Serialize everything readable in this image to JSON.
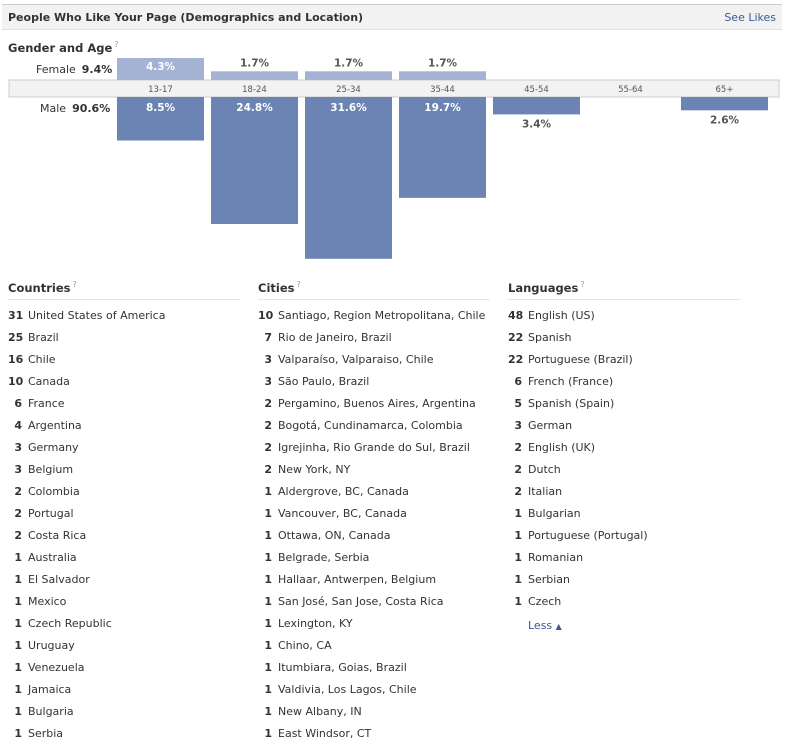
{
  "header": {
    "title": "People Who Like Your Page (Demographics and Location)",
    "see_likes": "See Likes"
  },
  "gender_age": {
    "title": "Gender and Age",
    "help": "?",
    "female_label": "Female",
    "female_pct": "9.4%",
    "male_label": "Male",
    "male_pct": "90.6%"
  },
  "colors": {
    "female": "#a4b3d4",
    "male": "#6b84b4",
    "axis_bg": "#f2f2f2",
    "link": "#3b5998"
  },
  "chart_data": {
    "type": "bar",
    "categories": [
      "13-17",
      "18-24",
      "25-34",
      "35-44",
      "45-54",
      "55-64",
      "65+"
    ],
    "series": [
      {
        "name": "Female",
        "values": [
          4.3,
          1.7,
          1.7,
          1.7,
          null,
          null,
          null
        ],
        "labels": [
          "4.3%",
          "1.7%",
          "1.7%",
          "1.7%",
          "",
          "",
          ""
        ]
      },
      {
        "name": "Male",
        "values": [
          8.5,
          24.8,
          31.6,
          19.7,
          3.4,
          null,
          2.6
        ],
        "labels": [
          "8.5%",
          "24.8%",
          "31.6%",
          "19.7%",
          "3.4%",
          "",
          "2.6%"
        ]
      }
    ]
  },
  "countries": {
    "title": "Countries",
    "help": "?",
    "items": [
      {
        "count": "31",
        "name": "United States of America"
      },
      {
        "count": "25",
        "name": "Brazil"
      },
      {
        "count": "16",
        "name": "Chile"
      },
      {
        "count": "10",
        "name": "Canada"
      },
      {
        "count": "6",
        "name": "France"
      },
      {
        "count": "4",
        "name": "Argentina"
      },
      {
        "count": "3",
        "name": "Germany"
      },
      {
        "count": "3",
        "name": "Belgium"
      },
      {
        "count": "2",
        "name": "Colombia"
      },
      {
        "count": "2",
        "name": "Portugal"
      },
      {
        "count": "2",
        "name": "Costa Rica"
      },
      {
        "count": "1",
        "name": "Australia"
      },
      {
        "count": "1",
        "name": "El Salvador"
      },
      {
        "count": "1",
        "name": "Mexico"
      },
      {
        "count": "1",
        "name": "Czech Republic"
      },
      {
        "count": "1",
        "name": "Uruguay"
      },
      {
        "count": "1",
        "name": "Venezuela"
      },
      {
        "count": "1",
        "name": "Jamaica"
      },
      {
        "count": "1",
        "name": "Bulgaria"
      },
      {
        "count": "1",
        "name": "Serbia"
      }
    ]
  },
  "cities": {
    "title": "Cities",
    "help": "?",
    "items": [
      {
        "count": "10",
        "name": "Santiago, Region Metropolitana, Chile"
      },
      {
        "count": "7",
        "name": "Rio de Janeiro, Brazil"
      },
      {
        "count": "3",
        "name": "Valparaíso, Valparaiso, Chile"
      },
      {
        "count": "3",
        "name": "São Paulo, Brazil"
      },
      {
        "count": "2",
        "name": "Pergamino, Buenos Aires, Argentina"
      },
      {
        "count": "2",
        "name": "Bogotá, Cundinamarca, Colombia"
      },
      {
        "count": "2",
        "name": "Igrejinha, Rio Grande do Sul, Brazil"
      },
      {
        "count": "2",
        "name": "New York, NY"
      },
      {
        "count": "1",
        "name": "Aldergrove, BC, Canada"
      },
      {
        "count": "1",
        "name": "Vancouver, BC, Canada"
      },
      {
        "count": "1",
        "name": "Ottawa, ON, Canada"
      },
      {
        "count": "1",
        "name": "Belgrade, Serbia"
      },
      {
        "count": "1",
        "name": "Hallaar, Antwerpen, Belgium"
      },
      {
        "count": "1",
        "name": "San José, San Jose, Costa Rica"
      },
      {
        "count": "1",
        "name": "Lexington, KY"
      },
      {
        "count": "1",
        "name": "Chino, CA"
      },
      {
        "count": "1",
        "name": "Itumbiara, Goias, Brazil"
      },
      {
        "count": "1",
        "name": "Valdivia, Los Lagos, Chile"
      },
      {
        "count": "1",
        "name": "New Albany, IN"
      },
      {
        "count": "1",
        "name": "East Windsor, CT"
      }
    ]
  },
  "languages": {
    "title": "Languages",
    "help": "?",
    "items": [
      {
        "count": "48",
        "name": "English (US)"
      },
      {
        "count": "22",
        "name": "Spanish"
      },
      {
        "count": "22",
        "name": "Portuguese (Brazil)"
      },
      {
        "count": "6",
        "name": "French (France)"
      },
      {
        "count": "5",
        "name": "Spanish (Spain)"
      },
      {
        "count": "3",
        "name": "German"
      },
      {
        "count": "2",
        "name": "English (UK)"
      },
      {
        "count": "2",
        "name": "Dutch"
      },
      {
        "count": "2",
        "name": "Italian"
      },
      {
        "count": "1",
        "name": "Bulgarian"
      },
      {
        "count": "1",
        "name": "Portuguese (Portugal)"
      },
      {
        "count": "1",
        "name": "Romanian"
      },
      {
        "count": "1",
        "name": "Serbian"
      },
      {
        "count": "1",
        "name": "Czech"
      }
    ],
    "less_label": "Less"
  }
}
